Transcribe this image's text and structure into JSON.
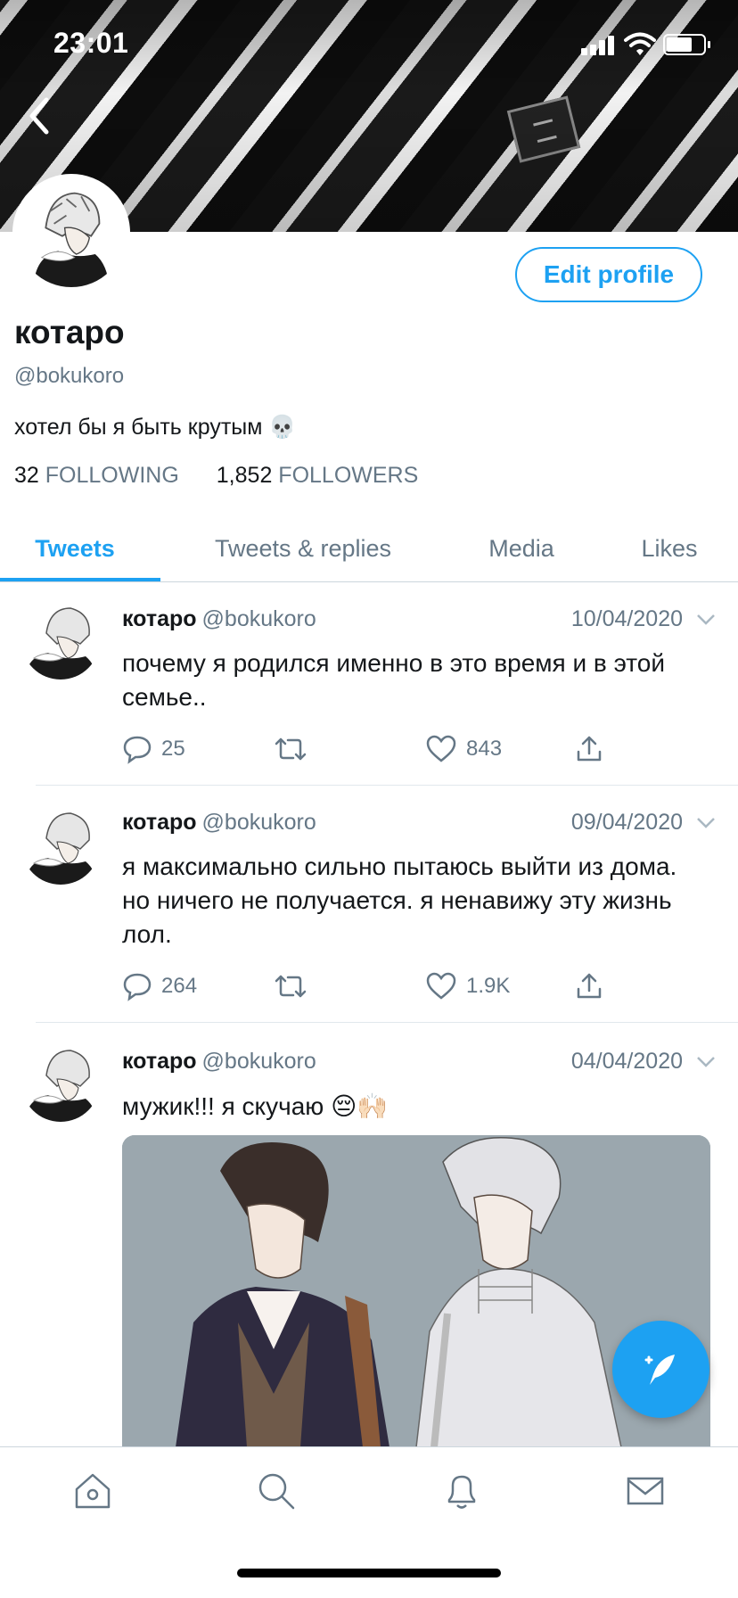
{
  "status_bar": {
    "time": "23:01"
  },
  "profile": {
    "name": "котаро",
    "handle": "@bokukoro",
    "bio": "хотел бы я быть крутым 💀",
    "following_count": "32",
    "following_label": "FOLLOWING",
    "followers_count": "1,852",
    "followers_label": "FOLLOWERS",
    "edit_label": "Edit profile"
  },
  "tabs": [
    {
      "label": "Tweets",
      "active": true
    },
    {
      "label": "Tweets & replies",
      "active": false
    },
    {
      "label": "Media",
      "active": false
    },
    {
      "label": "Likes",
      "active": false
    }
  ],
  "tweets": [
    {
      "name": "котаро",
      "handle": "@bokukoro",
      "date": "10/04/2020",
      "text": "почему я родился именно в это время и в этой семье..",
      "replies": "25",
      "retweets": "",
      "likes": "843"
    },
    {
      "name": "котаро",
      "handle": "@bokukoro",
      "date": "09/04/2020",
      "text": "я максимально сильно пытаюсь выйти из дома. но ничего не получается. я ненавижу эту жизнь лол.",
      "replies": "264",
      "retweets": "",
      "likes": "1.9K"
    },
    {
      "name": "котаро",
      "handle": "@bokukoro",
      "date": "04/04/2020",
      "text": "мужик!!! я скучаю 😔🙌🏻",
      "replies": "",
      "retweets": "",
      "likes": ""
    }
  ],
  "colors": {
    "accent": "#1da1f2",
    "secondary_text": "#657786",
    "primary_text": "#14171a"
  },
  "icons": {
    "back": "chevron-left-icon",
    "reply": "reply-icon",
    "retweet": "retweet-icon",
    "like": "heart-icon",
    "share": "share-icon",
    "compose": "compose-tweet-icon",
    "nav": [
      "home-icon",
      "search-icon",
      "notifications-icon",
      "messages-icon"
    ]
  }
}
